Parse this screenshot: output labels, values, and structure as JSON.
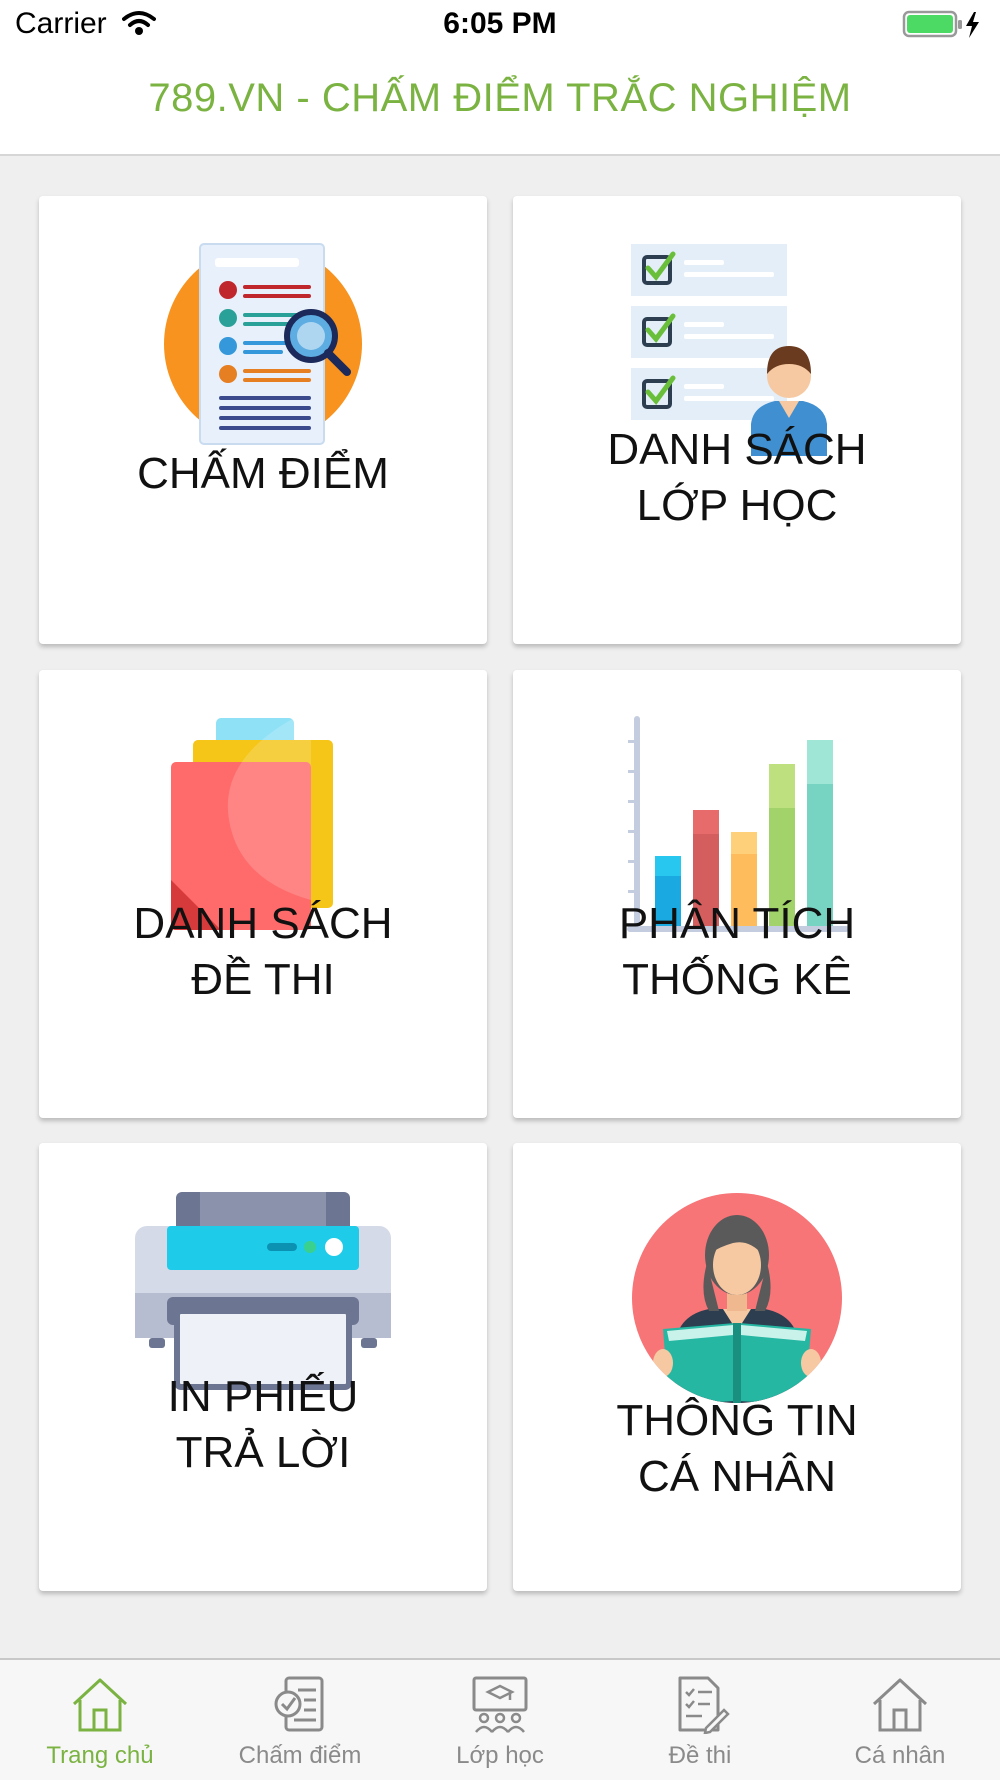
{
  "status_bar": {
    "carrier": "Carrier",
    "time": "6:05 PM"
  },
  "header": {
    "title": "789.VN - CHẤM ĐIỂM TRẮC NGHIỆM",
    "accent_color": "#7bb342"
  },
  "menu": [
    {
      "id": "cham-diem",
      "icon": "graded-sheet-magnifier-icon",
      "lines": [
        "CHẤM ĐIỂM"
      ]
    },
    {
      "id": "danh-sach-lop-hoc",
      "icon": "checklist-student-icon",
      "lines": [
        "DANH SÁCH",
        "LỚP HỌC"
      ]
    },
    {
      "id": "danh-sach-de-thi",
      "icon": "stacked-papers-icon",
      "lines": [
        "DANH SÁCH",
        "ĐỀ THI"
      ]
    },
    {
      "id": "phan-tich-thong-ke",
      "icon": "bar-chart-icon",
      "lines": [
        "PHÂN TÍCH",
        "THỐNG KÊ"
      ]
    },
    {
      "id": "in-phieu-tra-loi",
      "icon": "printer-icon",
      "lines": [
        "IN PHIẾU",
        "TRẢ LỜI"
      ]
    },
    {
      "id": "thong-tin-ca-nhan",
      "icon": "reading-person-icon",
      "lines": [
        "THÔNG TIN",
        "CÁ NHÂN"
      ]
    }
  ],
  "tabs": [
    {
      "label": "Trang chủ",
      "icon": "home-icon",
      "active": true
    },
    {
      "label": "Chấm điểm",
      "icon": "grading-sheet-icon",
      "active": false
    },
    {
      "label": "Lớp học",
      "icon": "classroom-icon",
      "active": false
    },
    {
      "label": "Đề thi",
      "icon": "exam-edit-icon",
      "active": false
    },
    {
      "label": "Cá nhân",
      "icon": "house-outline-icon",
      "active": false
    }
  ]
}
